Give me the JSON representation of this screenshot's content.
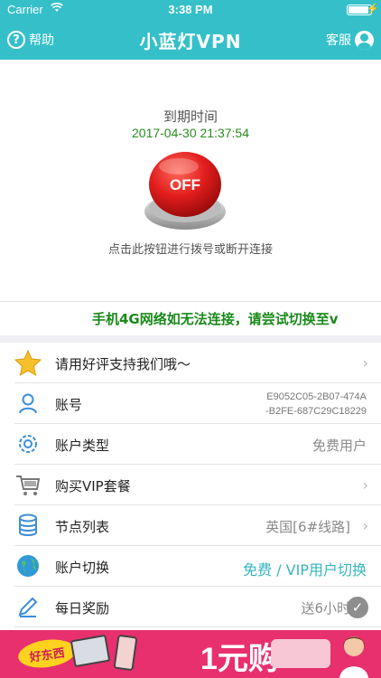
{
  "status_bar": {
    "carrier": "Carrier",
    "time": "3:38 PM"
  },
  "nav": {
    "help_label": "帮助",
    "title": "小蓝灯VPN",
    "service_label": "客服"
  },
  "hero": {
    "expire_label": "到期时间",
    "expire_time": "2017-04-30 21:37:54",
    "button_text": "OFF",
    "hint": "点击此按钮进行拨号或断开连接"
  },
  "marquee": "手机4G网络如无法连接，请尝试切换至v",
  "list": [
    {
      "label": "请用好评支持我们哦～",
      "value": "",
      "icon": "star-icon"
    },
    {
      "label": "账号",
      "value_line1": "E9052C05-2B07-474A",
      "value_line2": "-B2FE-687C29C18229",
      "icon": "user-icon"
    },
    {
      "label": "账户类型",
      "value": "免费用户",
      "icon": "gear-icon"
    },
    {
      "label": "购买VIP套餐",
      "value": "",
      "icon": "cart-icon"
    },
    {
      "label": "节点列表",
      "value": "英国[6#线路]",
      "icon": "database-icon"
    },
    {
      "label": "账户切换",
      "value": "免费 / VIP用户切换",
      "icon": "globe-icon"
    },
    {
      "label": "每日奖励",
      "value": "送6小时",
      "icon": "pencil-icon"
    }
  ],
  "ad": {
    "badge": "好东西",
    "main": "1元购"
  },
  "colors": {
    "header": "#35c0c9",
    "marquee": "#1b8a1b",
    "expire_time": "#2a8c1f",
    "accent": "#35b5c1",
    "button_red": "#d8141c"
  }
}
